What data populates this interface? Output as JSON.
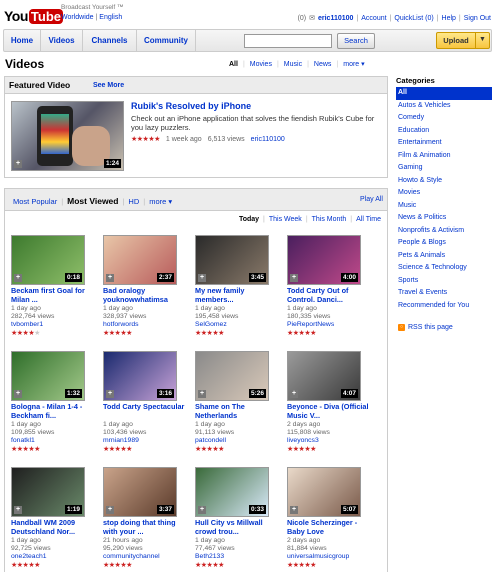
{
  "logo": {
    "you": "You",
    "tube": "Tube"
  },
  "tagline": "Broadcast Yourself ™",
  "world_links": {
    "worldwide": "Worldwide",
    "sep": "|",
    "language": "English"
  },
  "userbar": {
    "mail_count": "(0)",
    "username": "eric110100",
    "account": "Account",
    "quicklist": "QuickList (0)",
    "help": "Help",
    "signout": "Sign Out"
  },
  "nav": {
    "tabs": [
      "Home",
      "Videos",
      "Channels",
      "Community"
    ],
    "search_value": "",
    "search_button": "Search",
    "upload_button": "Upload"
  },
  "page": {
    "title": "Videos",
    "filters": [
      "All",
      "Movies",
      "Music",
      "News"
    ],
    "filters_more": "more ▾"
  },
  "featured": {
    "heading": "Featured Video",
    "see_more": "See More",
    "title": "Rubik's Resolved by iPhone",
    "description": "Check out an iPhone application that solves the fiendish Rubik's Cube for you lazy puzzlers.",
    "age": "1 week ago",
    "views": "6,513 views",
    "author": "eric110100",
    "duration": "1:24",
    "rating": 5
  },
  "list": {
    "tabs": [
      "Most Popular",
      "Most Viewed",
      "HD"
    ],
    "tabs_more": "more ▾",
    "play_all": "Play All",
    "times": [
      "Today",
      "This Week",
      "This Month",
      "All Time"
    ],
    "videos": [
      {
        "title": "Beckam first Goal for Milan ...",
        "age": "1 day ago",
        "views": "282,764 views",
        "author": "tvbomber1",
        "duration": "0:18",
        "rating": 4,
        "thumb": [
          "#3d7a2e",
          "#8fbf6a"
        ]
      },
      {
        "title": "Bad oralogy youknowwhatimsa",
        "age": "1 day ago",
        "views": "328,937 views",
        "author": "hotforwords",
        "duration": "2:37",
        "rating": 5,
        "thumb": [
          "#e8c6a8",
          "#b85b5b"
        ]
      },
      {
        "title": "My new family members...",
        "age": "1 day ago",
        "views": "195,458 views",
        "author": "SelGomez",
        "duration": "3:45",
        "rating": 5,
        "thumb": [
          "#2a2a2a",
          "#8a7a6a"
        ]
      },
      {
        "title": "Todd Carty Out of Control. Danci...",
        "age": "1 day ago",
        "views": "180,335 views",
        "author": "PieReportNews",
        "duration": "4:00",
        "rating": 5,
        "thumb": [
          "#4a1f5e",
          "#c04a8a"
        ]
      },
      {
        "title": "Bologna - Milan 1-4 - Beckham fi...",
        "age": "1 day ago",
        "views": "109,855 views",
        "author": "fonatkl1",
        "duration": "1:32",
        "rating": 5,
        "thumb": [
          "#2f6e2a",
          "#a3c98a"
        ]
      },
      {
        "title": "Todd Carty Spectacular",
        "age": "1 day ago",
        "views": "103,436 views",
        "author": "mrnian1989",
        "duration": "3:16",
        "rating": 5,
        "thumb": [
          "#1a2a6e",
          "#c9a3d8"
        ]
      },
      {
        "title": "Shame on The Netherlands",
        "age": "1 day ago",
        "views": "91,113 views",
        "author": "patcondell",
        "duration": "5:26",
        "rating": 5,
        "thumb": [
          "#8a8a8a",
          "#d9c9b9"
        ]
      },
      {
        "title": "Beyonce - Diva (Official Music V...",
        "age": "2 days ago",
        "views": "115,808 views",
        "author": "liveyoncs3",
        "duration": "4:07",
        "rating": 5,
        "thumb": [
          "#9a9a9a",
          "#3a3a3a"
        ]
      },
      {
        "title": "Handball WM 2009 Deutschland Nor...",
        "age": "1 day ago",
        "views": "92,725 views",
        "author": "one2teach1",
        "duration": "1:19",
        "rating": 5,
        "thumb": [
          "#1f1f1f",
          "#6a8a6a"
        ]
      },
      {
        "title": "stop doing that thing with your ...",
        "age": "21 hours ago",
        "views": "95,290 views",
        "author": "communitychannel",
        "duration": "3:37",
        "rating": 5,
        "thumb": [
          "#c9a38a",
          "#5a3a2a"
        ]
      },
      {
        "title": "Hull City vs Millwall crowd trou...",
        "age": "1 day ago",
        "views": "77,467 views",
        "author": "Beth2133",
        "duration": "0:33",
        "rating": 5,
        "thumb": [
          "#3a6a3a",
          "#d9e9f9"
        ]
      },
      {
        "title": "Nicole Scherzinger - Baby Love",
        "age": "2 days ago",
        "views": "81,884 views",
        "author": "universalmusicgroup",
        "duration": "5:07",
        "rating": 5,
        "thumb": [
          "#e9d9c9",
          "#7a5a4a"
        ]
      }
    ]
  },
  "categories": {
    "heading": "Categories",
    "items": [
      "All",
      "Autos & Vehicles",
      "Comedy",
      "Education",
      "Entertainment",
      "Film & Animation",
      "Gaming",
      "Howto & Style",
      "Movies",
      "Music",
      "News & Politics",
      "Nonprofits & Activism",
      "People & Blogs",
      "Pets & Animals",
      "Science & Technology",
      "Sports",
      "Travel & Events"
    ],
    "recommended": "Recommended for You",
    "rss": "RSS this page"
  }
}
